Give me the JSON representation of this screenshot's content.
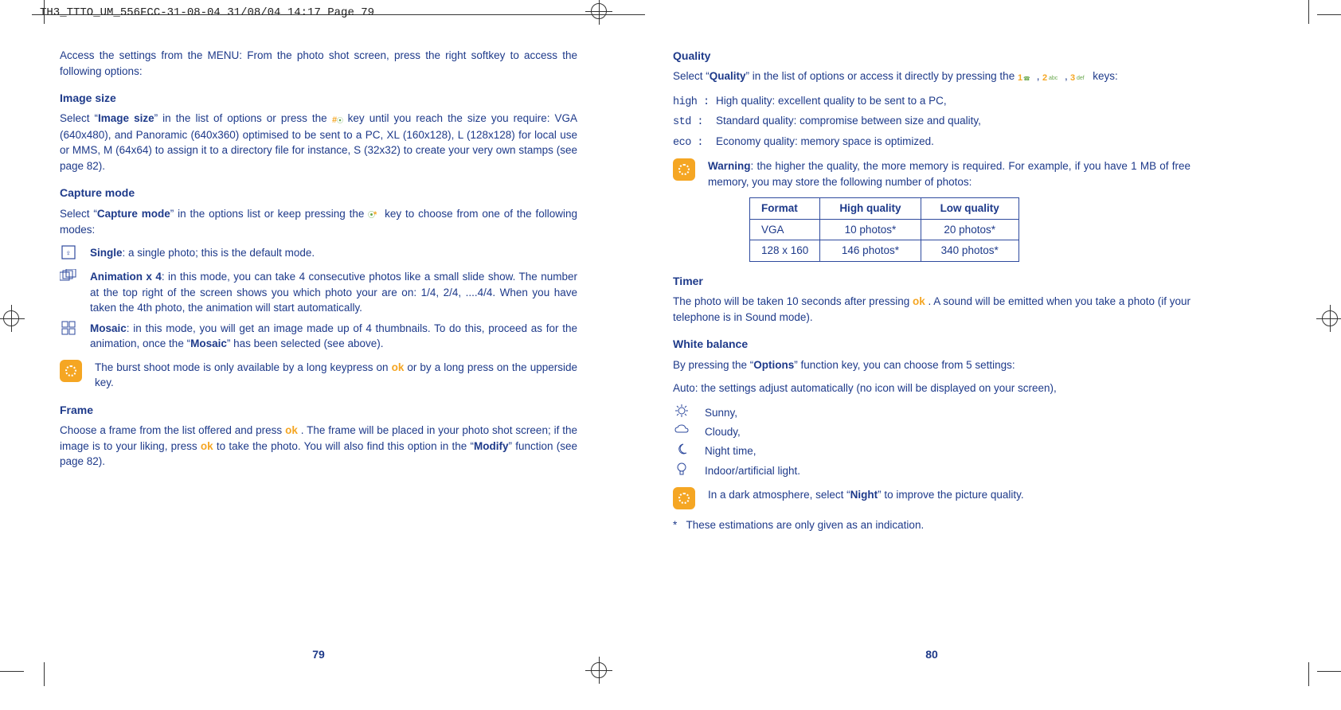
{
  "slug": "TH3_TTTO_UM_556FCC-31-08-04  31/08/04  14:17  Page 79",
  "left": {
    "intro": "Access the settings from the MENU: From the photo shot screen, press the right softkey to access the following options:",
    "image_size": {
      "heading": "Image size",
      "prefix": "Select “",
      "bold1": "Image size",
      "mid": "” in the list of options or press the ",
      "after_icon": " key until you reach the size you require: VGA (640x480), and Panoramic (640x360) optimised to be sent to a PC, XL (160x128), L (128x128) for local use or MMS, M (64x64) to assign it to a directory file for instance, S (32x32) to create your very own stamps (see page 82)."
    },
    "capture": {
      "heading": "Capture mode",
      "prefix": "Select “",
      "bold1": "Capture mode",
      "mid": "” in the options list or keep pressing the ",
      "after_icon": " key to choose from one of the following modes:",
      "single_label": "Single",
      "single_text": ": a single photo; this is the default mode.",
      "anim_label": "Animation x 4",
      "anim_text": ": in this mode, you can take 4 consecutive photos like a small slide show. The number at the top right of the screen shows you which photo your are on: 1/4, 2/4, ....4/4. When you have taken the 4th photo, the animation will start automatically.",
      "mosaic_label": "Mosaic",
      "mosaic_text_a": ": in this mode, you will get an image made up of 4 thumbnails. To do this, proceed as for the animation, once the “",
      "mosaic_bold": "Mosaic",
      "mosaic_text_b": "” has been selected (see above).",
      "tip_a": "The burst shoot mode is only available by a long keypress on ",
      "ok": "ok",
      "tip_b": " or by a long press on the upperside key."
    },
    "frame": {
      "heading": "Frame",
      "a": "Choose a frame from the list offered and press ",
      "ok1": "ok",
      "b": " . The frame will be placed in your photo shot screen; if the image is to your liking, press ",
      "ok2": "ok",
      "c": " to take the photo. You will also find this option in the “",
      "bold": "Modify",
      "d": "” function (see page 82)."
    },
    "pagenum": "79"
  },
  "right": {
    "quality": {
      "heading": "Quality",
      "line_a": "Select “",
      "bold": "Quality",
      "line_b": "” in the list of options or access it directly by pressing the ",
      "keys_tail": " keys:",
      "high_lbl": "high :",
      "high_txt": "High quality: excellent quality to be sent to a PC,",
      "std_lbl": "std :",
      "std_txt": "Standard quality: compromise between size and quality,",
      "eco_lbl": "eco :",
      "eco_txt": "Economy quality: memory space is optimized.",
      "warn_bold": "Warning",
      "warn": ": the higher the quality, the more memory is required. For example, if you have 1 MB of free memory, you may store the following number of photos:"
    },
    "table": {
      "h1": "Format",
      "h2": "High quality",
      "h3": "Low quality",
      "r1c1": "VGA",
      "r1c2": "10 photos*",
      "r1c3": "20 photos*",
      "r2c1": "128 x 160",
      "r2c2": "146 photos*",
      "r2c3": "340 photos*"
    },
    "timer": {
      "heading": "Timer",
      "a": "The photo will be taken 10 seconds after pressing ",
      "ok": "ok",
      "b": " . A sound will be emitted when you take a photo (if your telephone is in Sound mode)."
    },
    "wb": {
      "heading": "White balance",
      "intro_a": "By pressing the “",
      "bold": "Options",
      "intro_b": "” function key, you can choose from 5 settings:",
      "auto": "Auto: the settings adjust automatically (no icon will be displayed on your screen),",
      "sunny": "Sunny,",
      "cloudy": "Cloudy,",
      "night": "Night time,",
      "indoor": "Indoor/artificial light.",
      "tip_a": "In a dark atmosphere, select “",
      "tip_bold": "Night",
      "tip_b": "” to improve the picture quality."
    },
    "footnote_star": "*",
    "footnote": "These estimations are only given as an indication.",
    "pagenum": "80"
  }
}
